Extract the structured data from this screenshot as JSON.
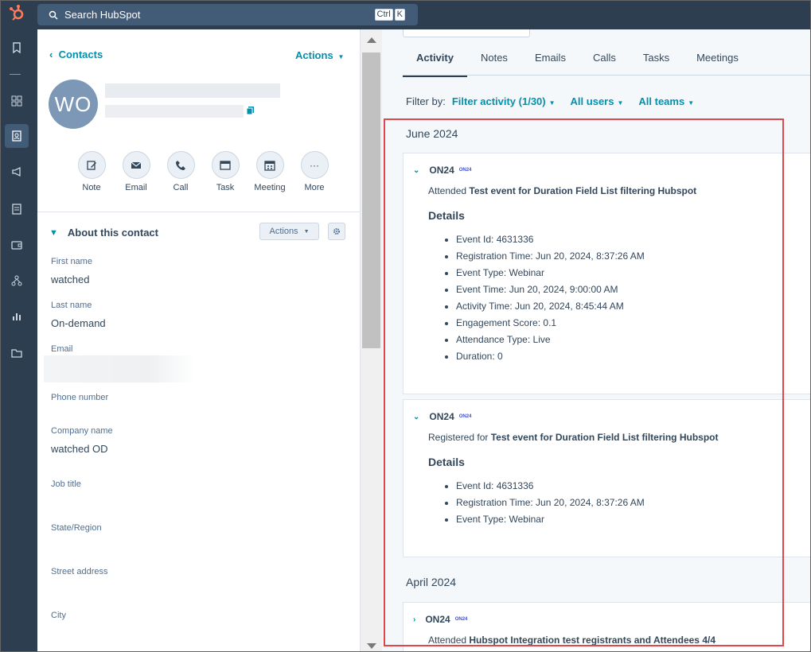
{
  "topbar": {
    "search_placeholder": "Search HubSpot",
    "kbd1": "Ctrl",
    "kbd2": "K"
  },
  "nav_icons": [
    "hubspot-logo-icon",
    "bookmark-icon",
    "grid-icon",
    "contacts-icon",
    "megaphone-icon",
    "documents-icon",
    "wallet-icon",
    "network-icon",
    "reports-icon",
    "folder-icon"
  ],
  "contact": {
    "back_label": "Contacts",
    "actions_label": "Actions",
    "initials": "WO",
    "quick_actions": [
      {
        "label": "Note"
      },
      {
        "label": "Email"
      },
      {
        "label": "Call"
      },
      {
        "label": "Task"
      },
      {
        "label": "Meeting"
      },
      {
        "label": "More"
      }
    ],
    "about_title": "About this contact",
    "about_actions": "Actions",
    "fields": [
      {
        "label": "First name",
        "value": "watched"
      },
      {
        "label": "Last name",
        "value": "On-demand"
      },
      {
        "label": "Email",
        "value": ""
      },
      {
        "label": "Phone number",
        "value": ""
      },
      {
        "label": "Company name",
        "value": "watched OD"
      },
      {
        "label": "Job title",
        "value": ""
      },
      {
        "label": "State/Region",
        "value": ""
      },
      {
        "label": "Street address",
        "value": ""
      },
      {
        "label": "City",
        "value": ""
      }
    ]
  },
  "tabs": [
    "Activity",
    "Notes",
    "Emails",
    "Calls",
    "Tasks",
    "Meetings"
  ],
  "filter": {
    "label": "Filter by:",
    "activity": "Filter activity (1/30)",
    "users": "All users",
    "teams": "All teams"
  },
  "months": [
    "June 2024",
    "April 2024"
  ],
  "cards": [
    {
      "source": "ON24",
      "badge": "ON24",
      "verb": "Attended",
      "event": "Test event for Duration Field List filtering Hubspot",
      "details_title": "Details",
      "details": [
        "Event Id: 4631336",
        "Registration Time: Jun 20, 2024, 8:37:26 AM",
        "Event Type: Webinar",
        "Event Time: Jun 20, 2024, 9:00:00 AM",
        "Activity Time: Jun 20, 2024, 8:45:44 AM",
        "Engagement Score: 0.1",
        "Attendance Type: Live",
        "Duration: 0"
      ]
    },
    {
      "source": "ON24",
      "badge": "ON24",
      "verb": "Registered for",
      "event": "Test event for Duration Field List filtering Hubspot",
      "details_title": "Details",
      "details": [
        "Event Id: 4631336",
        "Registration Time: Jun 20, 2024, 8:37:26 AM",
        "Event Type: Webinar"
      ]
    },
    {
      "source": "ON24",
      "badge": "ON24",
      "verb": "Attended",
      "event": "Hubspot Integration test registrants and Attendees 4/4"
    }
  ],
  "colors": {
    "accent": "#0091ae",
    "nav_bg": "#2d3e50",
    "highlight": "#e0474c"
  }
}
